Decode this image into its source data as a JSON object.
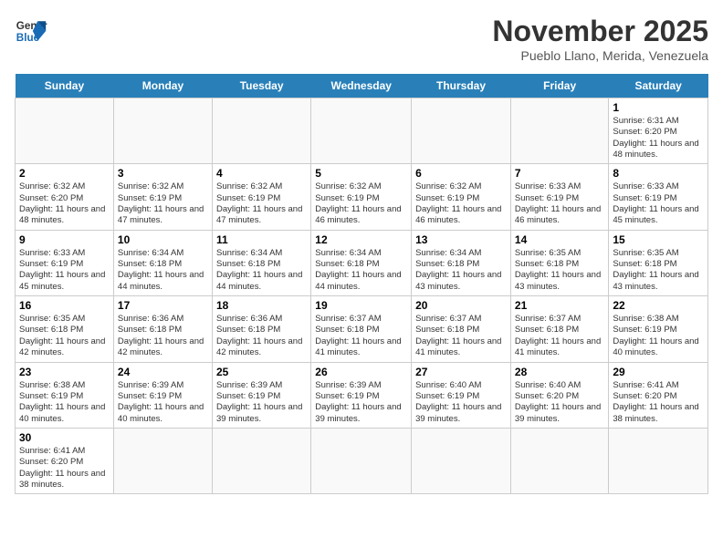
{
  "logo": {
    "text_general": "General",
    "text_blue": "Blue"
  },
  "header": {
    "month": "November 2025",
    "location": "Pueblo Llano, Merida, Venezuela"
  },
  "weekdays": [
    "Sunday",
    "Monday",
    "Tuesday",
    "Wednesday",
    "Thursday",
    "Friday",
    "Saturday"
  ],
  "weeks": [
    [
      {
        "day": "",
        "content": ""
      },
      {
        "day": "",
        "content": ""
      },
      {
        "day": "",
        "content": ""
      },
      {
        "day": "",
        "content": ""
      },
      {
        "day": "",
        "content": ""
      },
      {
        "day": "",
        "content": ""
      },
      {
        "day": "1",
        "content": "Sunrise: 6:31 AM\nSunset: 6:20 PM\nDaylight: 11 hours and 48 minutes."
      }
    ],
    [
      {
        "day": "2",
        "content": "Sunrise: 6:32 AM\nSunset: 6:20 PM\nDaylight: 11 hours and 48 minutes."
      },
      {
        "day": "3",
        "content": "Sunrise: 6:32 AM\nSunset: 6:19 PM\nDaylight: 11 hours and 47 minutes."
      },
      {
        "day": "4",
        "content": "Sunrise: 6:32 AM\nSunset: 6:19 PM\nDaylight: 11 hours and 47 minutes."
      },
      {
        "day": "5",
        "content": "Sunrise: 6:32 AM\nSunset: 6:19 PM\nDaylight: 11 hours and 46 minutes."
      },
      {
        "day": "6",
        "content": "Sunrise: 6:32 AM\nSunset: 6:19 PM\nDaylight: 11 hours and 46 minutes."
      },
      {
        "day": "7",
        "content": "Sunrise: 6:33 AM\nSunset: 6:19 PM\nDaylight: 11 hours and 46 minutes."
      },
      {
        "day": "8",
        "content": "Sunrise: 6:33 AM\nSunset: 6:19 PM\nDaylight: 11 hours and 45 minutes."
      }
    ],
    [
      {
        "day": "9",
        "content": "Sunrise: 6:33 AM\nSunset: 6:19 PM\nDaylight: 11 hours and 45 minutes."
      },
      {
        "day": "10",
        "content": "Sunrise: 6:34 AM\nSunset: 6:18 PM\nDaylight: 11 hours and 44 minutes."
      },
      {
        "day": "11",
        "content": "Sunrise: 6:34 AM\nSunset: 6:18 PM\nDaylight: 11 hours and 44 minutes."
      },
      {
        "day": "12",
        "content": "Sunrise: 6:34 AM\nSunset: 6:18 PM\nDaylight: 11 hours and 44 minutes."
      },
      {
        "day": "13",
        "content": "Sunrise: 6:34 AM\nSunset: 6:18 PM\nDaylight: 11 hours and 43 minutes."
      },
      {
        "day": "14",
        "content": "Sunrise: 6:35 AM\nSunset: 6:18 PM\nDaylight: 11 hours and 43 minutes."
      },
      {
        "day": "15",
        "content": "Sunrise: 6:35 AM\nSunset: 6:18 PM\nDaylight: 11 hours and 43 minutes."
      }
    ],
    [
      {
        "day": "16",
        "content": "Sunrise: 6:35 AM\nSunset: 6:18 PM\nDaylight: 11 hours and 42 minutes."
      },
      {
        "day": "17",
        "content": "Sunrise: 6:36 AM\nSunset: 6:18 PM\nDaylight: 11 hours and 42 minutes."
      },
      {
        "day": "18",
        "content": "Sunrise: 6:36 AM\nSunset: 6:18 PM\nDaylight: 11 hours and 42 minutes."
      },
      {
        "day": "19",
        "content": "Sunrise: 6:37 AM\nSunset: 6:18 PM\nDaylight: 11 hours and 41 minutes."
      },
      {
        "day": "20",
        "content": "Sunrise: 6:37 AM\nSunset: 6:18 PM\nDaylight: 11 hours and 41 minutes."
      },
      {
        "day": "21",
        "content": "Sunrise: 6:37 AM\nSunset: 6:18 PM\nDaylight: 11 hours and 41 minutes."
      },
      {
        "day": "22",
        "content": "Sunrise: 6:38 AM\nSunset: 6:19 PM\nDaylight: 11 hours and 40 minutes."
      }
    ],
    [
      {
        "day": "23",
        "content": "Sunrise: 6:38 AM\nSunset: 6:19 PM\nDaylight: 11 hours and 40 minutes."
      },
      {
        "day": "24",
        "content": "Sunrise: 6:39 AM\nSunset: 6:19 PM\nDaylight: 11 hours and 40 minutes."
      },
      {
        "day": "25",
        "content": "Sunrise: 6:39 AM\nSunset: 6:19 PM\nDaylight: 11 hours and 39 minutes."
      },
      {
        "day": "26",
        "content": "Sunrise: 6:39 AM\nSunset: 6:19 PM\nDaylight: 11 hours and 39 minutes."
      },
      {
        "day": "27",
        "content": "Sunrise: 6:40 AM\nSunset: 6:19 PM\nDaylight: 11 hours and 39 minutes."
      },
      {
        "day": "28",
        "content": "Sunrise: 6:40 AM\nSunset: 6:20 PM\nDaylight: 11 hours and 39 minutes."
      },
      {
        "day": "29",
        "content": "Sunrise: 6:41 AM\nSunset: 6:20 PM\nDaylight: 11 hours and 38 minutes."
      }
    ],
    [
      {
        "day": "30",
        "content": "Sunrise: 6:41 AM\nSunset: 6:20 PM\nDaylight: 11 hours and 38 minutes."
      },
      {
        "day": "",
        "content": ""
      },
      {
        "day": "",
        "content": ""
      },
      {
        "day": "",
        "content": ""
      },
      {
        "day": "",
        "content": ""
      },
      {
        "day": "",
        "content": ""
      },
      {
        "day": "",
        "content": ""
      }
    ]
  ]
}
